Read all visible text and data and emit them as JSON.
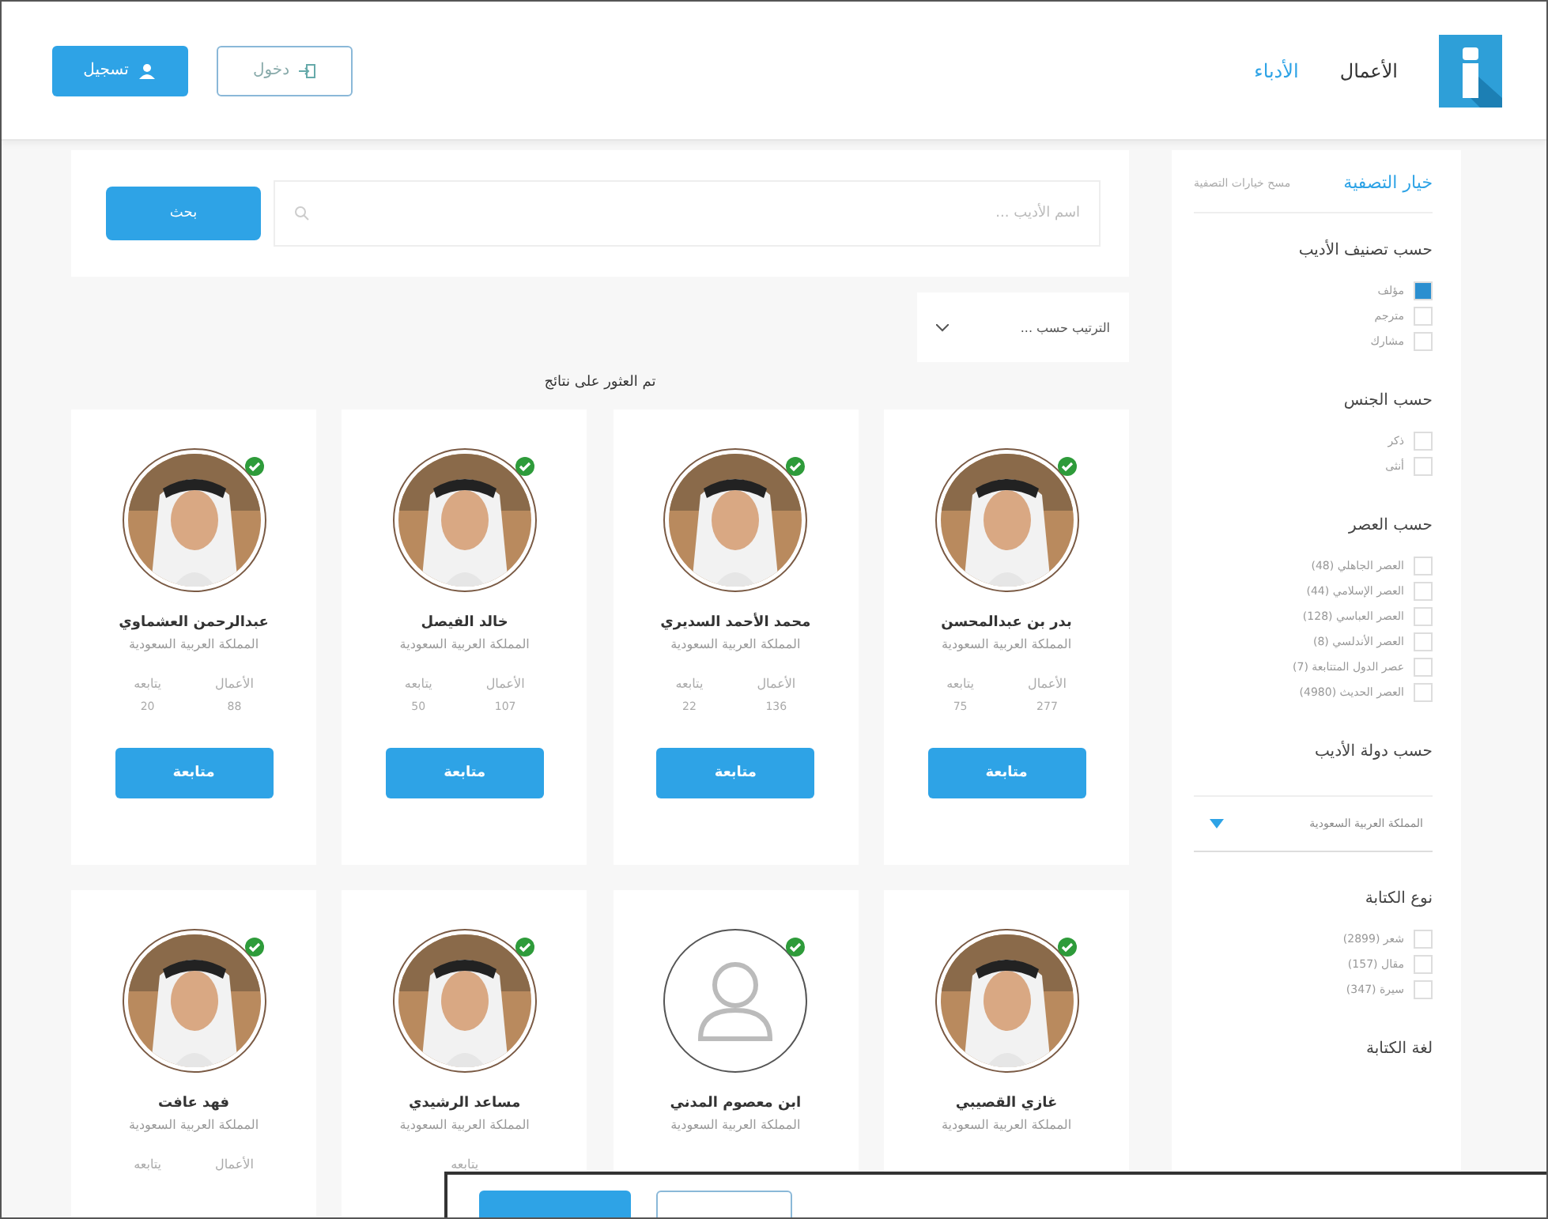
{
  "header": {
    "nav": [
      {
        "label": "الأعمال",
        "selected": false
      },
      {
        "label": "الأدباء",
        "selected": true
      }
    ],
    "buttons": [
      {
        "label": "دخول",
        "kind": "outline"
      },
      {
        "label": "تسجيل",
        "kind": "primary"
      }
    ]
  },
  "search": {
    "placeholder": "اسم الأديب ...",
    "button": "بحث"
  },
  "sort": {
    "placeholder": "الترتيب حسب ..."
  },
  "results_text": "تم العثور على نتائج",
  "sidebar": {
    "title": "خيار التصفية",
    "clear": "مسح خيارات التصفية",
    "groups": [
      {
        "title": "حسب تصنيف الأديب",
        "kind": "checks",
        "options": [
          {
            "label": "مؤلف",
            "checked": true
          },
          {
            "label": "مترجم",
            "checked": false
          },
          {
            "label": "مشارك",
            "checked": false
          }
        ]
      },
      {
        "title": "حسب الجنس",
        "kind": "checks",
        "options": [
          {
            "label": "ذكر",
            "checked": false
          },
          {
            "label": "أنثى",
            "checked": false
          }
        ]
      },
      {
        "title": "حسب العصر",
        "kind": "checks",
        "options": [
          {
            "label": "العصر الجاهلي (48)",
            "checked": false
          },
          {
            "label": "العصر الإسلامي (44)",
            "checked": false
          },
          {
            "label": "العصر العباسي (128)",
            "checked": false
          },
          {
            "label": "العصر الأندلسي (8)",
            "checked": false
          },
          {
            "label": "عصر الدول المتتابعة (7)",
            "checked": false
          },
          {
            "label": "العصر الحديث (4980)",
            "checked": false
          }
        ]
      },
      {
        "title": "حسب دولة الأديب",
        "kind": "select",
        "value": "المملكة العربية السعودية"
      },
      {
        "title": "نوع الكتابة",
        "kind": "checks",
        "options": [
          {
            "label": "شعر (2899)",
            "checked": false
          },
          {
            "label": "مقال (157)",
            "checked": false
          },
          {
            "label": "سيرة (347)",
            "checked": false
          }
        ]
      },
      {
        "title": "لغة الكتابة",
        "kind": "checks"
      }
    ]
  },
  "cards": [
    {
      "name": "بدر بن عبدالمحسن",
      "country": "المملكة العربية السعودية",
      "avatar": {
        "kind": "picture"
      },
      "verified": true,
      "stats": [
        {
          "label": "الأعمال",
          "value": "277"
        },
        {
          "label": "يتابعه",
          "value": "75"
        }
      ],
      "button": "متابعة"
    },
    {
      "name": "محمد الأحمد السديري",
      "country": "المملكة العربية السعودية",
      "avatar": {
        "kind": "picture"
      },
      "verified": true,
      "stats": [
        {
          "label": "الأعمال",
          "value": "136"
        },
        {
          "label": "يتابعه",
          "value": "22"
        }
      ],
      "button": "متابعة"
    },
    {
      "name": "خالد الفيصل",
      "country": "المملكة العربية السعودية",
      "avatar": {
        "kind": "picture"
      },
      "verified": true,
      "stats": [
        {
          "label": "الأعمال",
          "value": "107"
        },
        {
          "label": "يتابعه",
          "value": "50"
        }
      ],
      "button": "متابعة"
    },
    {
      "name": "عبدالرحمن العشماوي",
      "country": "المملكة العربية السعودية",
      "avatar": {
        "kind": "picture"
      },
      "verified": true,
      "stats": [
        {
          "label": "الأعمال",
          "value": "88"
        },
        {
          "label": "يتابعه",
          "value": "20"
        }
      ],
      "button": "متابعة"
    },
    {
      "name": "غازي القصيبي",
      "country": "المملكة العربية السعودية",
      "avatar": {
        "kind": "picture"
      },
      "verified": true
    },
    {
      "name": "ابن معصوم المدني",
      "country": "المملكة العربية السعودية",
      "avatar": {
        "kind": "placeholder"
      },
      "verified": true
    },
    {
      "name": "مساعد الرشيدي",
      "country": "المملكة العربية السعودية",
      "avatar": {
        "kind": "picture"
      },
      "verified": true,
      "stats": [
        {
          "label": "يتابعه"
        }
      ]
    },
    {
      "name": "فهد عافت",
      "country": "المملكة العربية السعودية",
      "avatar": {
        "kind": "picture"
      },
      "verified": true,
      "stats": [
        {
          "label": "الأعمال"
        },
        {
          "label": "يتابعه"
        }
      ]
    }
  ],
  "overlay_window": {
    "buttons": [
      {
        "kind": "primary"
      },
      {
        "kind": "outline"
      }
    ]
  }
}
